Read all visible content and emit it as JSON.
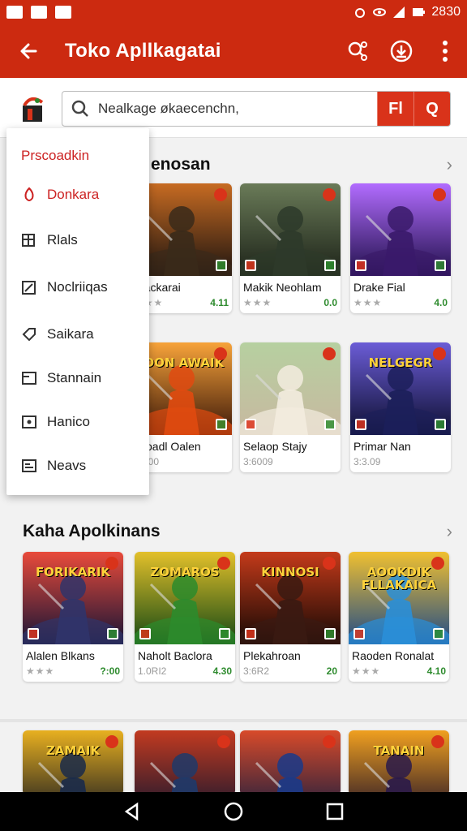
{
  "status_bar": {
    "time": "2830"
  },
  "app_bar": {
    "title": "Toko Apllkagatai",
    "back_icon": "back-arrow-icon",
    "actions": [
      "share-icon",
      "download-icon",
      "more-vert-icon"
    ]
  },
  "search": {
    "placeholder": "Nealkage økaecenchn,",
    "btn1": "Fl",
    "btn2": "Q"
  },
  "drawer": {
    "title": "Prscoadkin",
    "items": [
      {
        "label": "Donkara",
        "icon": "fire-icon",
        "active": true
      },
      {
        "label": "Rlals",
        "icon": "grid-icon",
        "active": false
      },
      {
        "label": "Noclriiqas",
        "icon": "edit-icon",
        "active": false
      },
      {
        "label": "Saikara",
        "icon": "tag-icon",
        "active": false
      },
      {
        "label": "Stannain",
        "icon": "folder-icon",
        "active": false
      },
      {
        "label": "Hanico",
        "icon": "info-icon",
        "active": false
      },
      {
        "label": "Neavs",
        "icon": "news-icon",
        "active": false
      }
    ]
  },
  "section1": {
    "title": "enosan",
    "cards": [
      {
        "name": "Mackarai",
        "stars": "★★★",
        "price": "4.11",
        "sub": "",
        "colors": [
          "#3a2a1a",
          "#c76b22",
          "#1d1410"
        ],
        "art_text": ""
      },
      {
        "name": "Makik Neohlam",
        "stars": "★★★",
        "price": "0.0",
        "sub": "",
        "colors": [
          "#2d3a2a",
          "#6a7b58",
          "#1c2218"
        ],
        "art_text": ""
      },
      {
        "name": "Drake Fial",
        "stars": "★★★",
        "price": "4.0",
        "sub": "",
        "colors": [
          "#3a1a6a",
          "#b26cff",
          "#20104a"
        ],
        "art_text": ""
      },
      {
        "name": "Kroadl Oalen",
        "stars": "",
        "price": "",
        "sub": "3:600",
        "colors": [
          "#e04a10",
          "#f7a33a",
          "#3a1608"
        ],
        "art_text": "JOON AWAIK"
      },
      {
        "name": "Selaop Stajy",
        "stars": "",
        "price": "",
        "sub": "3:6009",
        "colors": [
          "#f3ecdf",
          "#b6d0a0",
          "#c8b8a0"
        ],
        "art_text": ""
      },
      {
        "name": "Primar Nan",
        "stars": "",
        "price": "",
        "sub": "3:3.09",
        "colors": [
          "#1c1f5a",
          "#6b5cd6",
          "#0d0f30"
        ],
        "art_text": "NELGEGR"
      }
    ]
  },
  "section2": {
    "title": "Kaha Apolkinans",
    "cards": [
      {
        "name": "Alalen Blkans",
        "stars": "★★★",
        "price": "?:00",
        "colors": [
          "#30346a",
          "#e94a3a",
          "#141436"
        ],
        "art_text": "FORIKARIK"
      },
      {
        "name": "Naholt Baclora",
        "stars": "",
        "price": "4.30",
        "sub": "1.0RI2",
        "colors": [
          "#2c8b2c",
          "#e3c02a",
          "#134814"
        ],
        "art_text": "ZOMAROS"
      },
      {
        "name": "Plekahroan",
        "stars": "",
        "price": "20",
        "sub": "3:6R2",
        "colors": [
          "#3a1a12",
          "#c43a1a",
          "#140804"
        ],
        "art_text": "KINNOSI"
      },
      {
        "name": "Raoden Ronalat",
        "stars": "★★★",
        "price": "4.10",
        "colors": [
          "#2a8fd8",
          "#f0c030",
          "#1e4a88"
        ],
        "art_text": "AOOKDIK FLLAKAICA"
      }
    ]
  },
  "section3": {
    "cards": [
      {
        "colors": [
          "#1a2a4a",
          "#e8b020",
          "#0a1020"
        ],
        "art_text": "ZAMAIK"
      },
      {
        "colors": [
          "#1e3a6a",
          "#c23a20",
          "#0a1430"
        ],
        "art_text": ""
      },
      {
        "colors": [
          "#1a3a8a",
          "#d84a2a",
          "#0a1a40"
        ],
        "art_text": ""
      },
      {
        "colors": [
          "#2a1a4a",
          "#f0a020",
          "#120828"
        ],
        "art_text": "TANAIN"
      }
    ]
  },
  "nav": {
    "back": "back-triangle-icon",
    "home": "home-circle-icon",
    "recent": "recent-square-icon"
  }
}
